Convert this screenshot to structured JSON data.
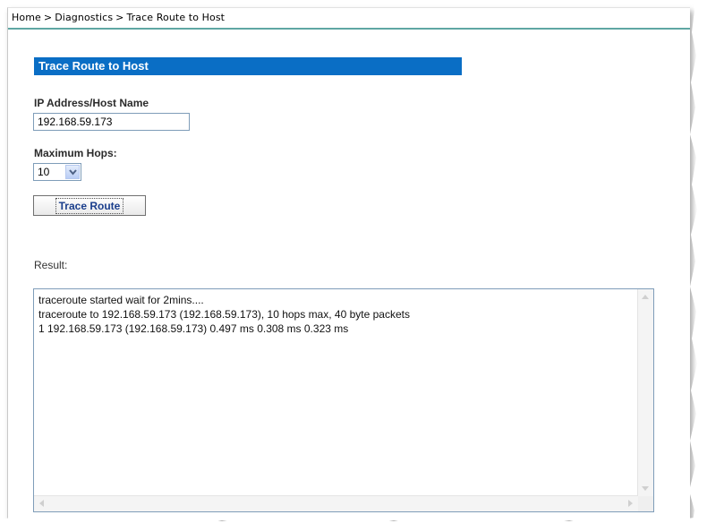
{
  "breadcrumb": {
    "items": [
      "Home",
      "Diagnostics",
      "Trace Route to Host"
    ],
    "separator": ">"
  },
  "section": {
    "title": "Trace Route to Host"
  },
  "form": {
    "ip_label": "IP Address/Host Name",
    "ip_value": "192.168.59.173",
    "hops_label": "Maximum Hops:",
    "hops_value": "10",
    "button_label": "Trace Route"
  },
  "result": {
    "label": "Result:",
    "lines": [
      "traceroute started wait for 2mins....",
      "traceroute to 192.168.59.173 (192.168.59.173), 10 hops max, 40 byte packets",
      "1 192.168.59.173 (192.168.59.173) 0.497 ms 0.308 ms 0.323 ms"
    ]
  },
  "colors": {
    "header_bg": "#0a6ec5",
    "rule": "#5fa7a3",
    "button_text": "#1a3e8c"
  },
  "icons": {
    "dropdown": "chevron-down-icon",
    "scroll_up": "arrow-up-icon",
    "scroll_down": "arrow-down-icon",
    "scroll_left": "arrow-left-icon",
    "scroll_right": "arrow-right-icon"
  }
}
